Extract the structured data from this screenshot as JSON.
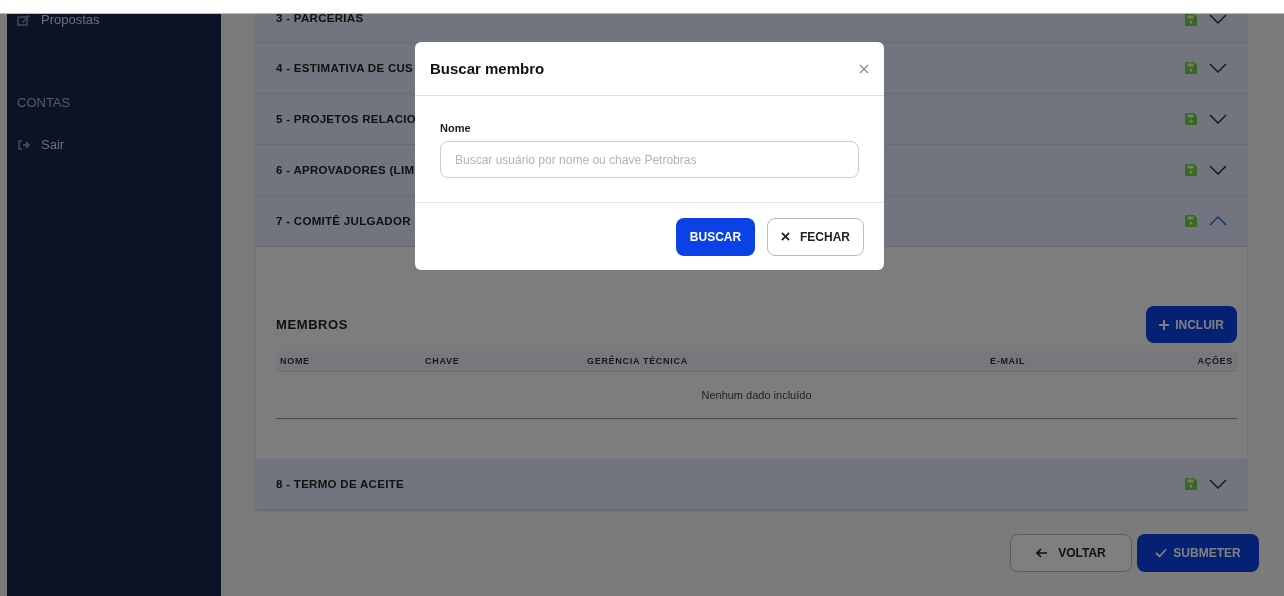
{
  "sidebar": {
    "items": [
      {
        "label": "Propostas",
        "kind": "link"
      },
      {
        "label": "CONTAS",
        "kind": "heading"
      },
      {
        "label": "Sair",
        "kind": "logout"
      }
    ]
  },
  "sections": [
    {
      "label": "3 - PARCERIAS",
      "saved": true,
      "expanded": false
    },
    {
      "label": "4 - ESTIMATIVA DE CUS",
      "saved": true,
      "expanded": false
    },
    {
      "label": "5 - PROJETOS RELACIO",
      "saved": true,
      "expanded": false
    },
    {
      "label": "6 - APROVADORES (LIM",
      "saved": true,
      "expanded": false
    },
    {
      "label": "7 - COMITÊ JULGADOR",
      "saved": true,
      "expanded": true
    },
    {
      "label": "8 - TERMO DE ACEITE",
      "saved": true,
      "expanded": false
    }
  ],
  "members": {
    "title": "MEMBROS",
    "add_button": "INCLUIR",
    "columns": [
      "NOME",
      "CHAVE",
      "GERÊNCIA TÉCNICA",
      "E-MAIL",
      "AÇÕES"
    ],
    "empty_message": "Nenhum dado incluído"
  },
  "footer": {
    "back_button": "VOLTAR",
    "submit_button": "SUBMETER"
  },
  "modal": {
    "title": "Buscar membro",
    "field_label": "Nome",
    "placeholder": "Buscar usuário por nome ou chave Petrobras",
    "search_button": "BUSCAR",
    "close_button": "FECHAR"
  }
}
